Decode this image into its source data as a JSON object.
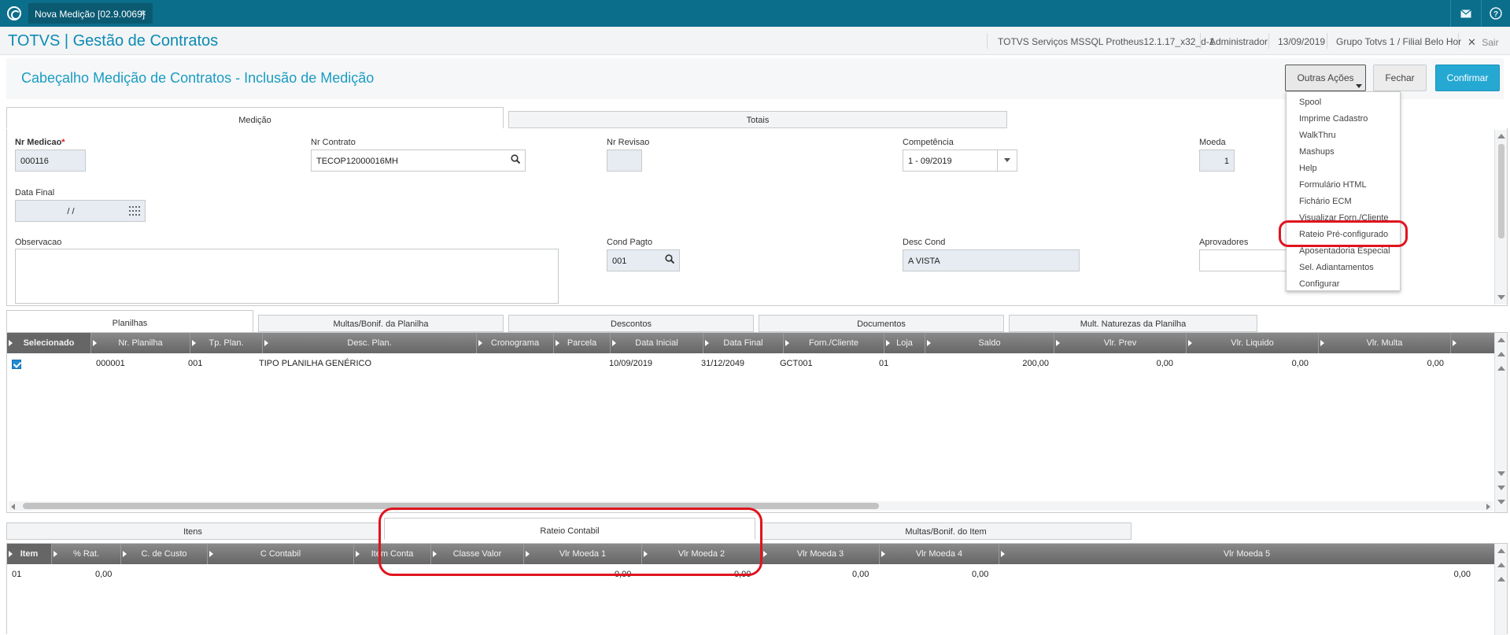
{
  "topbar": {
    "tab_label": "Nova Medição [02.9.0069]",
    "tab_close": "×"
  },
  "app_header": {
    "title": "TOTVS | Gestão de Contratos",
    "environment": "TOTVS Serviços MSSQL Protheus12.1.17_x32_d-1",
    "user": "Administrador",
    "date": "13/09/2019",
    "branch": "Grupo Totvs 1 / Filial Belo Hor",
    "logout": "Sair"
  },
  "page": {
    "title": "Cabeçalho Medição de Contratos - Inclusão de Medição",
    "actions_button": "Outras Ações",
    "close_button": "Fechar",
    "confirm_button": "Confirmar"
  },
  "top_tabs": [
    "Medição",
    "Totais"
  ],
  "form": {
    "nr_medicao_label": "Nr Medicao",
    "nr_medicao_required": "*",
    "nr_medicao_value": "000116",
    "nr_contrato_label": "Nr Contrato",
    "nr_contrato_value": "TECOP12000016MH",
    "nr_revisao_label": "Nr Revisao",
    "nr_revisao_value": "",
    "competencia_label": "Competência",
    "competencia_value": "1 - 09/2019",
    "moeda_label": "Moeda",
    "moeda_value": "1",
    "data_final_label": "Data Final",
    "data_final_value": "/ /",
    "observacao_label": "Observacao",
    "observacao_value": "",
    "cond_pagto_label": "Cond Pagto",
    "cond_pagto_value": "001",
    "desc_cond_label": "Desc Cond",
    "desc_cond_value": "A VISTA",
    "aprovadores_label": "Aprovadores",
    "aprovadores_value": ""
  },
  "dropdown_items": [
    "Spool",
    "Imprime Cadastro",
    "WalkThru",
    "Mashups",
    "Help",
    "Formulário HTML",
    "Fichário ECM",
    "Visualizar Forn./Cliente",
    "Rateio Pré-configurado",
    "Aposentadoria Especial",
    "Sel. Adiantamentos",
    "Configurar"
  ],
  "mid_tabs": [
    "Planilhas",
    "Multas/Bonif. da Planilha",
    "Descontos",
    "Documentos",
    "Mult. Naturezas da Planilha"
  ],
  "planilhas_grid": {
    "columns": [
      "Selecionado",
      "Nr. Planilha",
      "Tp. Plan.",
      "Desc. Plan.",
      "Cronograma",
      "Parcela",
      "Data Inicial",
      "Data Final",
      "Forn./Cliente",
      "Loja",
      "Saldo",
      "Vlr. Prev",
      "Vlr. Liquido",
      "Vlr. Multa"
    ],
    "rows": [
      {
        "nr_planilha": "000001",
        "tp_plan": "001",
        "desc_plan": "TIPO PLANILHA GENÉRICO",
        "data_inicial": "10/09/2019",
        "data_final": "31/12/2049",
        "forn_cliente": "GCT001",
        "loja": "01",
        "saldo": "200,00",
        "vlr_prev": "0,00",
        "vlr_liquido": "0,00",
        "vlr_multa": "0,00"
      }
    ]
  },
  "bottom_tabs": [
    "Itens",
    "Rateio Contabil",
    "Multas/Bonif. do Item"
  ],
  "rateio_grid": {
    "columns": [
      "Item",
      "% Rat.",
      "C. de Custo",
      "C Contabil",
      "Item Conta",
      "Classe Valor",
      "Vlr Moeda 1",
      "Vlr Moeda 2",
      "Vlr Moeda 3",
      "Vlr Moeda 4",
      "Vlr Moeda 5"
    ],
    "rows": [
      {
        "item": "01",
        "rat": "0,00",
        "vlr_moeda_1": "0,00",
        "vlr_moeda_2": "0,00",
        "vlr_moeda_3": "0,00",
        "vlr_moeda_4": "0,00",
        "vlr_moeda_5": "0,00"
      }
    ]
  },
  "colors": {
    "topbar": "#0b6e8a",
    "accent": "#1a9cc3",
    "primary_button": "#25a9d3",
    "highlight": "#e0141e"
  }
}
